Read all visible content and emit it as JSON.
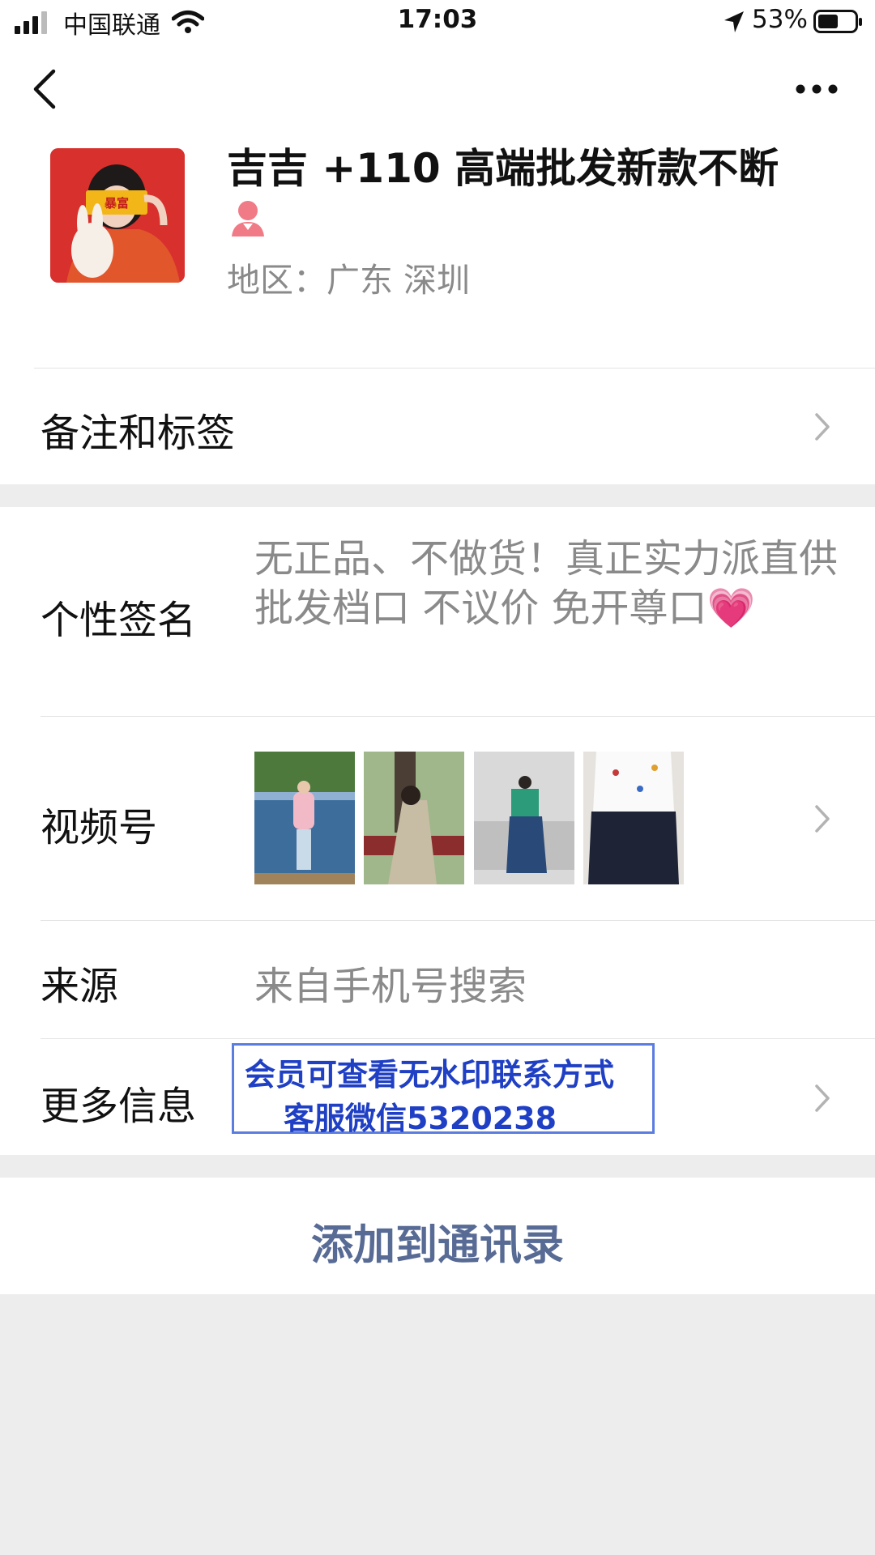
{
  "status_bar": {
    "carrier": "中国联通",
    "time": "17:03",
    "battery": "53%"
  },
  "profile": {
    "name": "吉吉 +110 高端批发新款不断",
    "avatar_badge": "暴富",
    "region": "地区：广东 深圳"
  },
  "rows": {
    "remark_label": "备注和标签",
    "signature_label": "个性签名",
    "signature_text": "无正品、不做货！真正实力派直供 批发档口 不议价 免开尊口💗",
    "channels_label": "视频号",
    "source_label": "来源",
    "source_value": "来自手机号搜索",
    "more_label": "更多信息"
  },
  "watermark": {
    "line1": "会员可查看无水印联系方式",
    "line2": "客服微信5320238"
  },
  "add_button": "添加到通讯录",
  "colors": {
    "background": "#ededed",
    "secondary_text": "#8a8a8a",
    "link_text": "#586b95",
    "watermark_text": "#1f3fc4"
  }
}
